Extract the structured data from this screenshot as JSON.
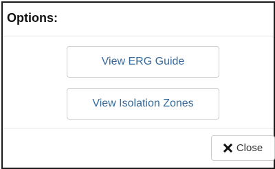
{
  "dialog": {
    "title": "Options:"
  },
  "options": {
    "erg_guide_label": "View ERG Guide",
    "isolation_zones_label": "View Isolation Zones"
  },
  "footer": {
    "close_label": "Close",
    "close_icon": "close-icon"
  },
  "colors": {
    "button_text": "#34699a",
    "border": "#1a1a1a",
    "divider": "#e5e5e5"
  }
}
